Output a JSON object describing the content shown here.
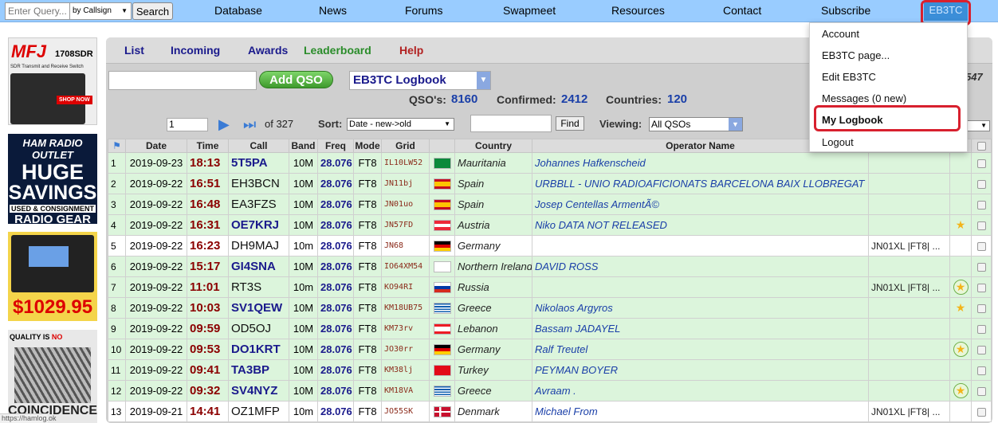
{
  "topnav": {
    "search_placeholder": "Enter Query...",
    "search_type": "by Callsign",
    "search_button": "Search",
    "links": [
      "Database",
      "News",
      "Forums",
      "Swapmeet",
      "Resources",
      "Contact",
      "Subscribe"
    ],
    "user": "EB3TC"
  },
  "user_menu": {
    "items": [
      "Account",
      "EB3TC page...",
      "Edit EB3TC",
      "Messages (0 new)",
      "My Logbook",
      "Logout"
    ]
  },
  "ads": {
    "mfj_logo": "MFJ",
    "mfj_model": "1708SDR",
    "mfj_sub": "SDR Transmit and Receive Switch",
    "mfj_shop": "SHOP NOW",
    "hro_a": "HAM RADIO OUTLET",
    "hro_b": "HUGE",
    "hro_c": "SAVINGS",
    "hro_d": "USED & CONSIGNMENT",
    "hro_e": "RADIO GEAR",
    "radio_price": "$1029.95",
    "coin_top_a": "QUALITY",
    "coin_top_b": "IS",
    "coin_top_c": "NO",
    "coin_name": "COINCIDENCE"
  },
  "logbook": {
    "tabs": [
      "List",
      "Incoming",
      "Awards",
      "Leaderboard",
      "Help"
    ],
    "add_qso": "Add QSO",
    "logbook_select": "EB3TC Logbook",
    "side_number": "547",
    "stats": {
      "qsos_label": "QSO's:",
      "qsos": "8160",
      "confirmed_label": "Confirmed:",
      "confirmed": "2412",
      "countries_label": "Countries:",
      "countries": "120"
    },
    "page": "1",
    "page_of": "of 327",
    "sort_label": "Sort:",
    "sort_value": "Date - new->old",
    "find_button": "Find",
    "viewing_label": "Viewing:",
    "viewing_value": "All QSOs",
    "per_page_value": "5"
  },
  "table": {
    "headers": [
      "Date",
      "Time",
      "Call",
      "Band",
      "Freq",
      "Mode",
      "Grid",
      "Country",
      "Operator Name"
    ],
    "rows": [
      {
        "n": "1",
        "date": "2019-09-23",
        "time": "18:13",
        "call": "5T5PA",
        "band": "10M",
        "freq": "28.076",
        "mode": "FT8",
        "grid": "IL10LW52",
        "flag": "mauritania",
        "country": "Mauritania",
        "op": "Johannes Hafkenscheid",
        "extra": "",
        "star": "",
        "confirmed": true,
        "shade": "g"
      },
      {
        "n": "2",
        "date": "2019-09-22",
        "time": "16:51",
        "call": "EH3BCN",
        "band": "10M",
        "freq": "28.076",
        "mode": "FT8",
        "grid": "JN11bj",
        "flag": "spain",
        "country": "Spain",
        "op": "URBBLL - UNIO RADIOAFICIONATS BARCELONA BAIX LLOBREGAT",
        "extra": "",
        "star": "",
        "confirmed": false,
        "shade": "g"
      },
      {
        "n": "3",
        "date": "2019-09-22",
        "time": "16:48",
        "call": "EA3FZS",
        "band": "10M",
        "freq": "28.076",
        "mode": "FT8",
        "grid": "JN01uo",
        "flag": "spain",
        "country": "Spain",
        "op": "Josep Centellas ArmentÃ©",
        "extra": "",
        "star": "",
        "confirmed": false,
        "shade": "g"
      },
      {
        "n": "4",
        "date": "2019-09-22",
        "time": "16:31",
        "call": "OE7KRJ",
        "band": "10M",
        "freq": "28.076",
        "mode": "FT8",
        "grid": "JN57FD",
        "flag": "austria",
        "country": "Austria",
        "op": "Niko DATA NOT RELEASED",
        "extra": "",
        "star": "star",
        "confirmed": true,
        "shade": "g"
      },
      {
        "n": "5",
        "date": "2019-09-22",
        "time": "16:23",
        "call": "DH9MAJ",
        "band": "10m",
        "freq": "28.076",
        "mode": "FT8",
        "grid": "JN68",
        "flag": "germany",
        "country": "Germany",
        "op": "",
        "extra": "JN01XL |FT8| ...",
        "star": "",
        "confirmed": false,
        "shade": "w"
      },
      {
        "n": "6",
        "date": "2019-09-22",
        "time": "15:17",
        "call": "GI4SNA",
        "band": "10M",
        "freq": "28.076",
        "mode": "FT8",
        "grid": "IO64XM54",
        "flag": "uk",
        "country": "Northern Ireland",
        "op": "DAVID ROSS",
        "extra": "",
        "star": "",
        "confirmed": true,
        "shade": "g"
      },
      {
        "n": "7",
        "date": "2019-09-22",
        "time": "11:01",
        "call": "RT3S",
        "band": "10m",
        "freq": "28.076",
        "mode": "FT8",
        "grid": "KO94RI",
        "flag": "russia",
        "country": "Russia",
        "op": "",
        "extra": "JN01XL |FT8| ...",
        "star": "circle",
        "confirmed": false,
        "shade": "g"
      },
      {
        "n": "8",
        "date": "2019-09-22",
        "time": "10:03",
        "call": "SV1QEW",
        "band": "10M",
        "freq": "28.076",
        "mode": "FT8",
        "grid": "KM18UB75",
        "flag": "greece",
        "country": "Greece",
        "op": "Nikolaos Argyros",
        "extra": "",
        "star": "star",
        "confirmed": true,
        "shade": "g"
      },
      {
        "n": "9",
        "date": "2019-09-22",
        "time": "09:59",
        "call": "OD5OJ",
        "band": "10M",
        "freq": "28.076",
        "mode": "FT8",
        "grid": "KM73rv",
        "flag": "lebanon",
        "country": "Lebanon",
        "op": "Bassam JADAYEL",
        "extra": "",
        "star": "",
        "confirmed": false,
        "shade": "g"
      },
      {
        "n": "10",
        "date": "2019-09-22",
        "time": "09:53",
        "call": "DO1KRT",
        "band": "10M",
        "freq": "28.076",
        "mode": "FT8",
        "grid": "JO30rr",
        "flag": "germany",
        "country": "Germany",
        "op": "Ralf Treutel",
        "extra": "",
        "star": "circle",
        "confirmed": true,
        "shade": "g"
      },
      {
        "n": "11",
        "date": "2019-09-22",
        "time": "09:41",
        "call": "TA3BP",
        "band": "10M",
        "freq": "28.076",
        "mode": "FT8",
        "grid": "KM38lj",
        "flag": "turkey",
        "country": "Turkey",
        "op": "PEYMAN BOYER",
        "extra": "",
        "star": "",
        "confirmed": true,
        "shade": "g"
      },
      {
        "n": "12",
        "date": "2019-09-22",
        "time": "09:32",
        "call": "SV4NYZ",
        "band": "10M",
        "freq": "28.076",
        "mode": "FT8",
        "grid": "KM18VA",
        "flag": "greece",
        "country": "Greece",
        "op": "Avraam .",
        "extra": "",
        "star": "circle",
        "confirmed": true,
        "shade": "g"
      },
      {
        "n": "13",
        "date": "2019-09-21",
        "time": "14:41",
        "call": "OZ1MFP",
        "band": "10m",
        "freq": "28.076",
        "mode": "FT8",
        "grid": "JO55SK",
        "flag": "denmark",
        "country": "Denmark",
        "op": "Michael From",
        "extra": "JN01XL |FT8| ...",
        "star": "",
        "confirmed": false,
        "shade": "w"
      }
    ]
  },
  "status_url": "https://hamlog.ok",
  "colors": {
    "nav_bg": "#99ccff",
    "accent_red": "#d8202e",
    "confirmed_call": "#1a1a8c",
    "time": "#8b0000",
    "row_green": "#dcf5dc"
  }
}
